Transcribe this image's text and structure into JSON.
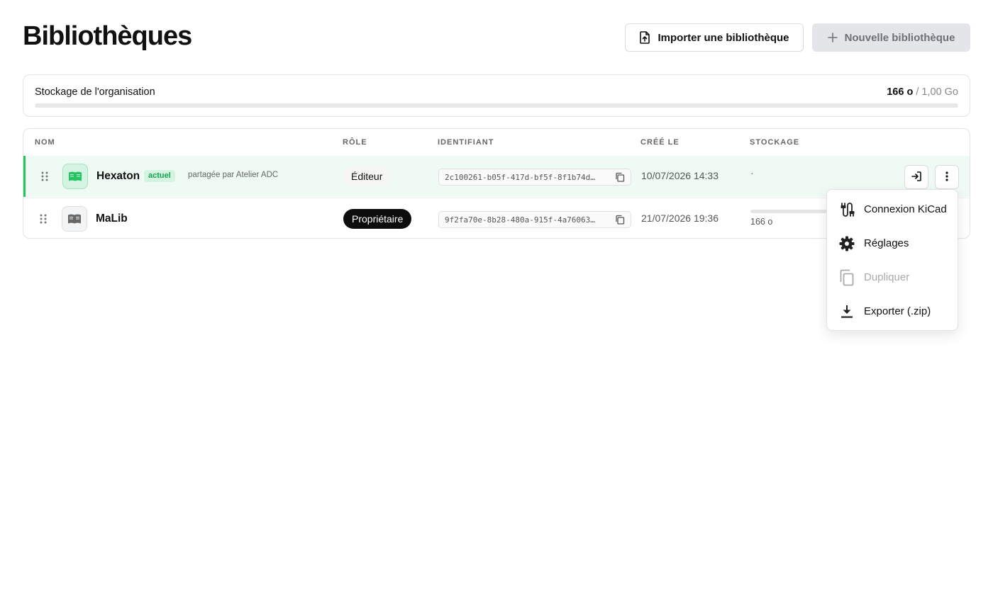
{
  "header": {
    "title": "Bibliothèques",
    "import_label": "Importer une bibliothèque",
    "new_label": "Nouvelle bibliothèque"
  },
  "storage": {
    "label": "Stockage de l'organisation",
    "used": "166 o",
    "separator": " / ",
    "total": "1,00 Go",
    "fraction": 0.0
  },
  "table": {
    "columns": [
      "NOM",
      "RÔLE",
      "IDENTIFIANT",
      "CRÉÉ LE",
      "STOCKAGE"
    ],
    "rows": [
      {
        "name": "Hexaton",
        "badge": "actuel",
        "shared": "partagée par Atelier ADC",
        "role": "Éditeur",
        "id": "2c100261-b05f-417d-bf5f-8f1b74d…",
        "created": "10/07/2026 14:33",
        "storage": "·",
        "accent": "#22c55e"
      },
      {
        "name": "MaLib",
        "role": "Propriétaire",
        "id": "9f2fa70e-8b28-480a-915f-4a76063…",
        "created": "21/07/2026 19:36",
        "storage": "166 o"
      }
    ]
  },
  "menu": {
    "items": [
      {
        "label": "Connexion KiCad",
        "icon": "plug-icon",
        "disabled": false
      },
      {
        "label": "Réglages",
        "icon": "gear-icon",
        "disabled": false
      },
      {
        "label": "Dupliquer",
        "icon": "copy-icon",
        "disabled": true
      },
      {
        "label": "Exporter (.zip)",
        "icon": "download-icon",
        "disabled": false
      }
    ]
  },
  "colors": {
    "accent": "#22c55e",
    "accent_bg": "#eefaf3",
    "owner_badge": "#0d0d0d",
    "disabled_button": "#e4e5e8"
  }
}
